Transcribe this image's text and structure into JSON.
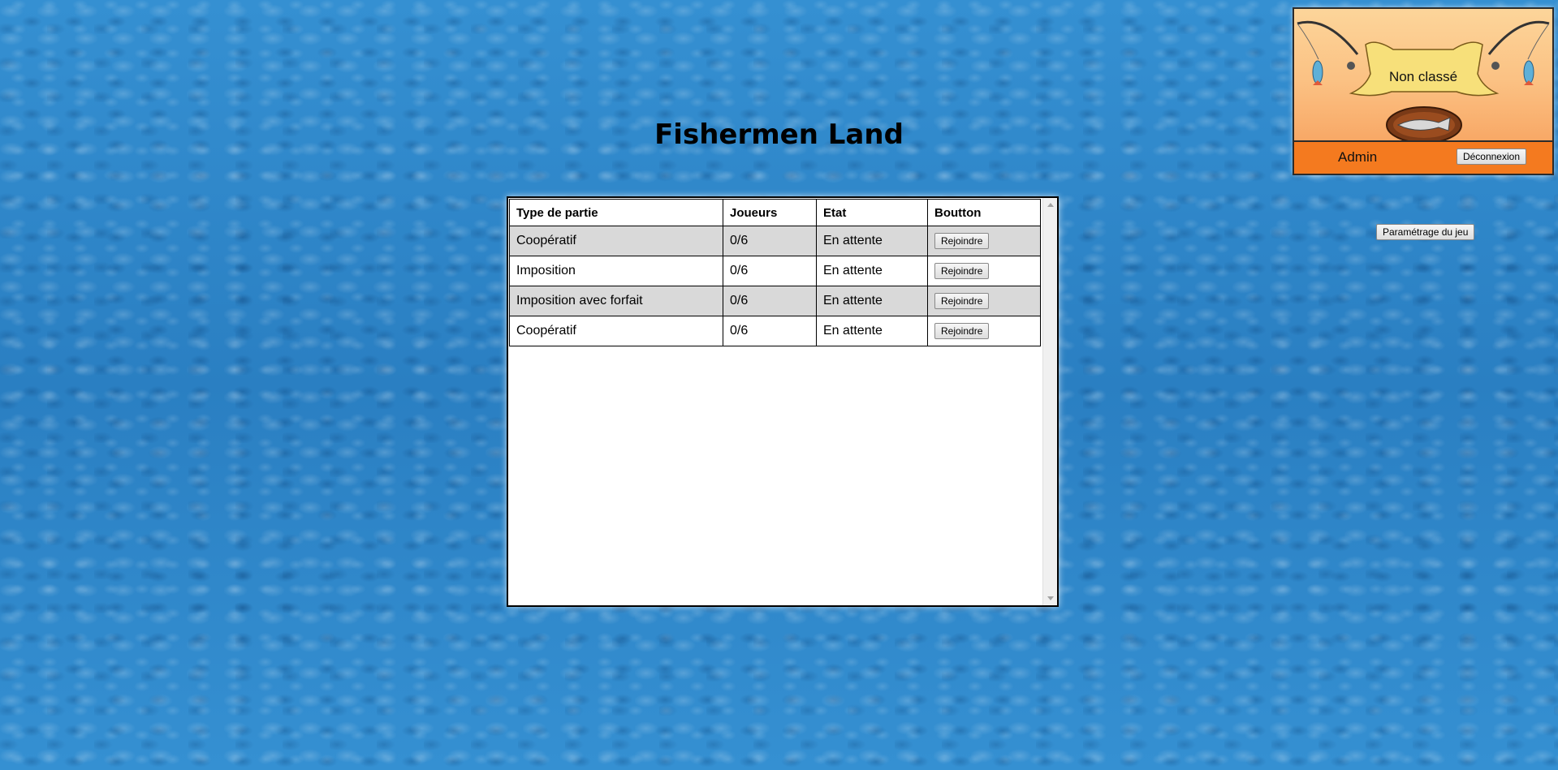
{
  "page": {
    "title": "Fishermen Land"
  },
  "profile": {
    "rank": "Non classé",
    "username": "Admin",
    "logout_label": "Déconnexion"
  },
  "settings_label": "Paramétrage du jeu",
  "games_table": {
    "headers": {
      "type": "Type de partie",
      "players": "Joueurs",
      "state": "Etat",
      "button": "Boutton"
    },
    "rows": [
      {
        "type": "Coopératif",
        "players": "0/6",
        "state": "En attente",
        "action": "Rejoindre"
      },
      {
        "type": "Imposition",
        "players": "0/6",
        "state": "En attente",
        "action": "Rejoindre"
      },
      {
        "type": "Imposition avec forfait",
        "players": "0/6",
        "state": "En attente",
        "action": "Rejoindre"
      },
      {
        "type": "Coopératif",
        "players": "0/6",
        "state": "En attente",
        "action": "Rejoindre"
      }
    ]
  },
  "colors": {
    "background": "#2f86c9",
    "profile_bar": "#f47a1f",
    "row_alt": "#d9d9d9"
  },
  "icons": {
    "profile_art": "fishing-rods-banner-icon",
    "trophy": "fish-plaque-icon"
  }
}
